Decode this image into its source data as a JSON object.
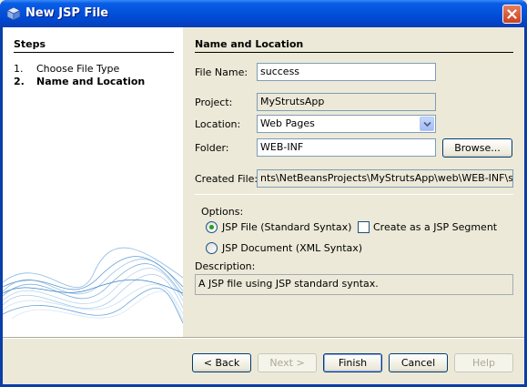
{
  "window": {
    "title": "New JSP File"
  },
  "steps": {
    "heading": "Steps",
    "items": [
      {
        "num": "1.",
        "label": "Choose File Type"
      },
      {
        "num": "2.",
        "label": "Name and Location"
      }
    ]
  },
  "form": {
    "heading": "Name and Location",
    "file_name_label": "File Name:",
    "file_name_value": "success",
    "project_label": "Project:",
    "project_value": "MyStrutsApp",
    "location_label": "Location:",
    "location_value": "Web Pages",
    "folder_label": "Folder:",
    "folder_value": "WEB-INF",
    "browse_label": "Browse...",
    "created_file_label": "Created File:",
    "created_file_value": "nts\\NetBeansProjects\\MyStrutsApp\\web\\WEB-INF\\succes",
    "options_label": "Options:",
    "option_jsp_standard": "JSP File (Standard Syntax)",
    "option_jsp_xml": "JSP Document (XML Syntax)",
    "option_segment": "Create as a JSP Segment",
    "description_label": "Description:",
    "description_value": "A JSP file using JSP standard syntax."
  },
  "buttons": {
    "back": "< Back",
    "next": "Next >",
    "finish": "Finish",
    "cancel": "Cancel",
    "help": "Help"
  }
}
